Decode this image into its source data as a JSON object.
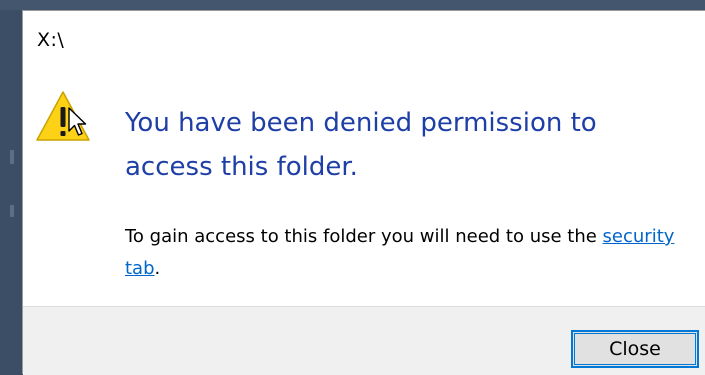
{
  "dialog": {
    "title": "X:\\",
    "heading": "You have been denied permission to access this folder.",
    "body_prefix": "To gain access to this folder you will need to use the ",
    "link_label": "security tab",
    "body_suffix": ".",
    "close_label": "Close"
  },
  "icons": {
    "warning": "warning-icon",
    "cursor": "mouse-cursor-icon"
  },
  "colors": {
    "heading": "#1e3fa6",
    "link": "#0066cc",
    "button_border": "#0078d7",
    "warning_fill": "#fcd116"
  }
}
